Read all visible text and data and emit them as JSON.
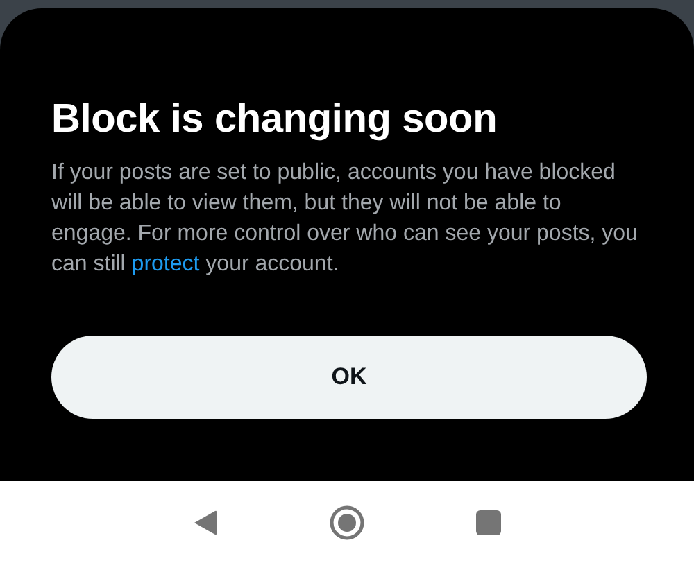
{
  "sheet": {
    "title": "Block is changing soon",
    "body_before": "If your posts are set to public, accounts you have blocked will be able to view them, but they will not be able to engage. For more control over who can see your posts, you can still ",
    "link": "protect",
    "body_after": " your account.",
    "button": "OK"
  },
  "nav_bar": {
    "buttons": [
      {
        "kind": "back"
      },
      {
        "kind": "home"
      },
      {
        "kind": "recents"
      }
    ]
  }
}
